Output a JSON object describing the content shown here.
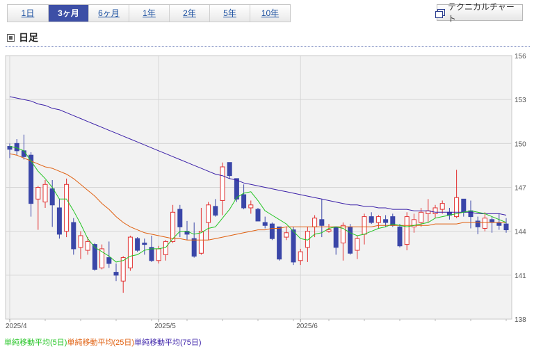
{
  "tabs": [
    {
      "label": "1日",
      "active": false
    },
    {
      "label": "3ヶ月",
      "active": true
    },
    {
      "label": "6ヶ月",
      "active": false
    },
    {
      "label": "1年",
      "active": false
    },
    {
      "label": "2年",
      "active": false
    },
    {
      "label": "5年",
      "active": false
    },
    {
      "label": "10年",
      "active": false
    }
  ],
  "technical_button": {
    "label": "テクニカルチャート",
    "icon": "window-icon"
  },
  "section": {
    "title": "日足",
    "icon": "square-bullet-icon"
  },
  "legend": [
    {
      "label": "単純移動平均(5日)",
      "color": "#22c422"
    },
    {
      "label": "単純移動平均(25日)",
      "color": "#e06010"
    },
    {
      "label": "単純移動平均(75日)",
      "color": "#3a1fa8"
    }
  ],
  "chart_data": {
    "type": "candlestick",
    "ylim": [
      138,
      156
    ],
    "y_ticks": [
      138,
      141,
      144,
      147,
      150,
      153,
      156
    ],
    "x_tick_labels": [
      "2025/4",
      "2025/5",
      "2025/6"
    ],
    "x_tick_index": [
      0,
      21,
      41
    ],
    "grid": true,
    "colors": {
      "up": "#e23030",
      "down": "#3a46a8",
      "ma5": "#22c422",
      "ma25": "#e06010",
      "ma75": "#3a1fa8"
    },
    "candles": [
      [
        149.8,
        150.0,
        149.0,
        149.6
      ],
      [
        150.0,
        150.3,
        149.2,
        149.5
      ],
      [
        149.5,
        150.6,
        148.9,
        149.1
      ],
      [
        149.2,
        149.4,
        145.0,
        145.9
      ],
      [
        146.2,
        147.1,
        144.1,
        147.0
      ],
      [
        146.0,
        147.5,
        145.6,
        147.2
      ],
      [
        146.9,
        147.5,
        144.3,
        145.8
      ],
      [
        145.6,
        146.2,
        143.5,
        143.8
      ],
      [
        144.0,
        147.6,
        143.6,
        147.2
      ],
      [
        144.6,
        144.9,
        142.4,
        142.8
      ],
      [
        142.9,
        144.0,
        142.1,
        143.7
      ],
      [
        142.7,
        143.6,
        142.4,
        143.3
      ],
      [
        143.1,
        143.2,
        141.3,
        141.4
      ],
      [
        141.5,
        143.1,
        141.4,
        142.8
      ],
      [
        142.2,
        143.3,
        141.5,
        141.8
      ],
      [
        141.2,
        141.8,
        140.6,
        141.0
      ],
      [
        140.6,
        142.3,
        139.8,
        142.2
      ],
      [
        141.5,
        143.7,
        141.3,
        143.6
      ],
      [
        143.5,
        143.6,
        142.6,
        142.7
      ],
      [
        143.2,
        143.5,
        142.4,
        143.1
      ],
      [
        142.9,
        143.7,
        141.9,
        142.0
      ],
      [
        142.0,
        143.0,
        141.8,
        142.8
      ],
      [
        142.4,
        143.4,
        142.0,
        143.3
      ],
      [
        143.3,
        145.8,
        143.2,
        145.3
      ],
      [
        145.5,
        145.8,
        143.6,
        144.3
      ],
      [
        144.0,
        144.7,
        143.4,
        143.8
      ],
      [
        143.5,
        144.6,
        142.2,
        142.3
      ],
      [
        142.5,
        145.6,
        142.4,
        144.0
      ],
      [
        144.6,
        146.0,
        143.4,
        145.8
      ],
      [
        145.7,
        146.2,
        145.0,
        145.1
      ],
      [
        146.1,
        148.7,
        145.1,
        148.4
      ],
      [
        148.7,
        148.7,
        147.6,
        147.8
      ],
      [
        147.6,
        147.6,
        146.0,
        146.2
      ],
      [
        146.5,
        147.2,
        145.5,
        145.6
      ],
      [
        145.6,
        146.1,
        145.2,
        145.8
      ],
      [
        145.5,
        145.6,
        144.7,
        144.7
      ],
      [
        144.6,
        145.0,
        144.2,
        144.4
      ],
      [
        144.5,
        144.6,
        143.4,
        143.5
      ],
      [
        144.3,
        144.3,
        142.0,
        142.1
      ],
      [
        143.6,
        144.3,
        143.4,
        143.9
      ],
      [
        144.1,
        144.3,
        141.7,
        141.9
      ],
      [
        142.0,
        142.8,
        141.7,
        142.6
      ],
      [
        142.9,
        144.3,
        141.9,
        144.0
      ],
      [
        144.3,
        145.1,
        143.6,
        144.9
      ],
      [
        144.8,
        146.2,
        143.6,
        144.4
      ],
      [
        144.0,
        144.5,
        143.9,
        144.1
      ],
      [
        144.3,
        144.3,
        142.4,
        142.9
      ],
      [
        143.2,
        144.6,
        142.0,
        144.4
      ],
      [
        144.3,
        144.5,
        142.4,
        142.5
      ],
      [
        142.7,
        143.7,
        142.1,
        143.5
      ],
      [
        143.8,
        145.2,
        143.1,
        145.0
      ],
      [
        145.0,
        145.3,
        144.5,
        144.6
      ],
      [
        144.6,
        145.1,
        144.2,
        145.0
      ],
      [
        144.8,
        145.1,
        144.3,
        144.6
      ],
      [
        145.0,
        145.2,
        144.3,
        144.4
      ],
      [
        144.3,
        144.5,
        142.9,
        143.0
      ],
      [
        143.1,
        145.3,
        142.7,
        145.0
      ],
      [
        144.3,
        145.2,
        143.9,
        144.8
      ],
      [
        144.6,
        145.6,
        144.3,
        145.3
      ],
      [
        145.2,
        146.2,
        144.6,
        145.4
      ],
      [
        145.2,
        145.8,
        144.9,
        145.6
      ],
      [
        145.5,
        146.1,
        145.2,
        145.9
      ],
      [
        145.3,
        145.6,
        144.8,
        145.1
      ],
      [
        145.0,
        148.2,
        144.9,
        146.3
      ],
      [
        146.2,
        146.2,
        145.0,
        145.3
      ],
      [
        145.4,
        146.1,
        144.2,
        145.0
      ],
      [
        144.7,
        145.0,
        143.8,
        144.3
      ],
      [
        144.2,
        145.3,
        144.0,
        144.9
      ],
      [
        144.8,
        145.0,
        143.9,
        144.6
      ],
      [
        144.6,
        145.2,
        144.1,
        144.4
      ],
      [
        144.5,
        144.9,
        143.9,
        144.1
      ]
    ],
    "ma5": [
      149.8,
      149.7,
      149.5,
      148.8,
      148.1,
      147.6,
      147.0,
      146.2,
      146.2,
      145.4,
      144.5,
      143.5,
      142.9,
      142.6,
      142.3,
      141.9,
      142.0,
      142.3,
      142.4,
      142.7,
      142.8,
      142.8,
      142.9,
      143.5,
      144.0,
      144.0,
      143.8,
      143.9,
      144.2,
      144.3,
      144.9,
      145.5,
      146.3,
      146.6,
      146.7,
      146.1,
      145.4,
      145.1,
      144.8,
      144.5,
      144.0,
      143.5,
      143.4,
      143.8,
      143.9,
      144.2,
      144.3,
      144.2,
      143.9,
      143.7,
      143.8,
      144.0,
      144.2,
      144.3,
      144.5,
      144.4,
      144.3,
      144.4,
      144.5,
      144.6,
      144.9,
      145.0,
      145.1,
      145.2,
      145.3,
      145.4,
      145.3,
      145.2,
      145.0,
      144.8,
      144.6
    ],
    "ma25": [
      149.3,
      149.2,
      149.0,
      148.8,
      148.6,
      148.4,
      148.3,
      148.1,
      147.9,
      147.6,
      147.2,
      146.8,
      146.4,
      145.9,
      145.5,
      145.0,
      144.6,
      144.3,
      144.1,
      143.9,
      143.8,
      143.7,
      143.6,
      143.5,
      143.5,
      143.4,
      143.4,
      143.4,
      143.4,
      143.5,
      143.6,
      143.7,
      143.8,
      143.9,
      144.0,
      144.1,
      144.1,
      144.2,
      144.2,
      144.3,
      144.3,
      144.3,
      144.3,
      144.3,
      144.3,
      144.3,
      144.3,
      144.3,
      144.3,
      144.3,
      144.3,
      144.3,
      144.4,
      144.4,
      144.4,
      144.4,
      144.4,
      144.4,
      144.4,
      144.4,
      144.5,
      144.5,
      144.5,
      144.5,
      144.6,
      144.6,
      144.6,
      144.6,
      144.6,
      144.6,
      144.6
    ],
    "ma75": [
      153.2,
      153.1,
      153.0,
      152.9,
      152.7,
      152.6,
      152.4,
      152.3,
      152.1,
      151.9,
      151.7,
      151.5,
      151.3,
      151.1,
      150.9,
      150.7,
      150.5,
      150.3,
      150.1,
      149.9,
      149.7,
      149.5,
      149.3,
      149.1,
      148.9,
      148.7,
      148.5,
      148.3,
      148.1,
      147.9,
      147.8,
      147.6,
      147.5,
      147.3,
      147.2,
      147.1,
      147.0,
      146.9,
      146.8,
      146.7,
      146.6,
      146.5,
      146.4,
      146.3,
      146.2,
      146.1,
      146.0,
      145.9,
      145.8,
      145.8,
      145.7,
      145.7,
      145.6,
      145.6,
      145.5,
      145.5,
      145.5,
      145.4,
      145.4,
      145.4,
      145.3,
      145.3,
      145.3,
      145.3,
      145.3,
      145.3,
      145.2,
      145.2,
      145.2,
      145.2,
      145.1
    ]
  }
}
